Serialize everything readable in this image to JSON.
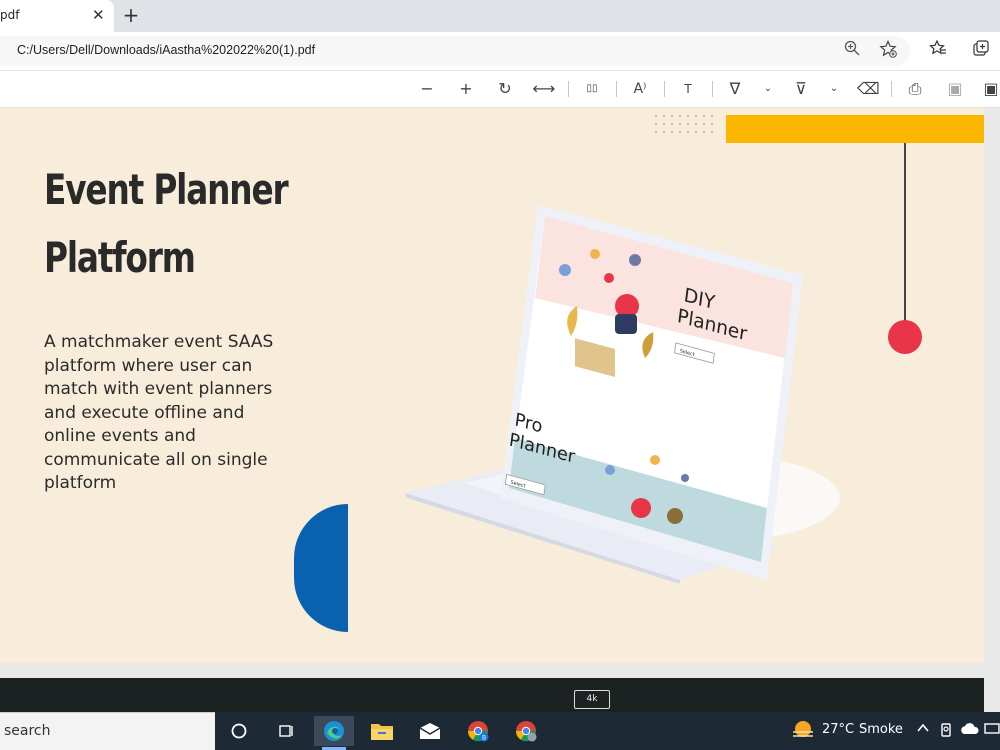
{
  "browser": {
    "tab": {
      "title": "pdf",
      "close": "✕"
    },
    "new_tab": "+",
    "address": {
      "url": "C:/Users/Dell/Downloads/iAastha%202022%20(1).pdf"
    }
  },
  "pdf_toolbar": {
    "zoom_out": "−",
    "zoom_in": "+",
    "rotate": "↻",
    "fit": "⟷",
    "page_view": "▯▯",
    "read_aloud": "A⁾",
    "text_box": "T",
    "draw": "∇",
    "highlight": "⊽",
    "erase": "⌫",
    "print": "⎙",
    "save": "▣",
    "dropdown": "⌄"
  },
  "slide": {
    "title_line1": "Event Planner",
    "title_line2": "Platform",
    "description": "A matchmaker event SAAS platform where user can match with event planners and execute offline and online events and communicate all on single platform",
    "laptop_screen": {
      "right_heading_line1": "DIY",
      "right_heading_line2": "Planner",
      "left_heading_line1": "Pro",
      "left_heading_line2": "Planner",
      "button": "Select"
    }
  },
  "next_page": {
    "badge": "4k"
  },
  "taskbar": {
    "search_placeholder": "search",
    "weather_temp": "27°C",
    "weather_desc": "Smoke"
  },
  "colors": {
    "slide_bg": "#f8eddb",
    "accent_yellow": "#fbb700",
    "accent_red": "#e8354a",
    "accent_blue": "#0a61b0"
  }
}
